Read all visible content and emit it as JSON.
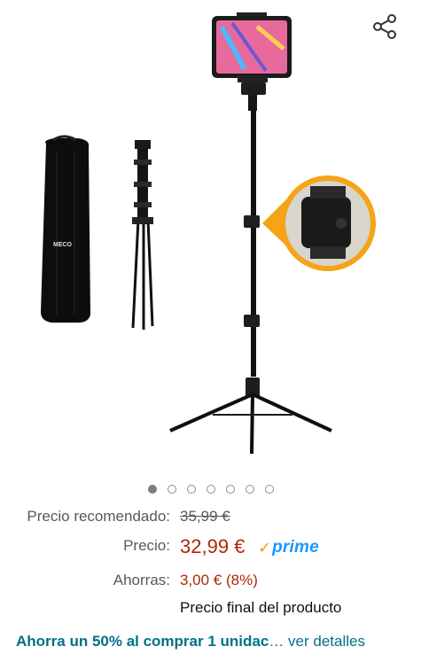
{
  "gallery": {
    "image_count": 7,
    "active_index": 0,
    "bag_logo_text": "MECO",
    "share_icon": "share-icon"
  },
  "pricing": {
    "recommended_label": "Precio recomendado:",
    "recommended_value": "35,99 €",
    "price_label": "Precio:",
    "price_value": "32,99 €",
    "prime_label": "prime",
    "savings_label": "Ahorras:",
    "savings_value": "3,00 € (8%)",
    "final_note": "Precio final del producto"
  },
  "promo": {
    "text": "Ahorra un 50% al comprar 1 unidad",
    "more_link": "ver detalles",
    "ellipsis": "…"
  },
  "colors": {
    "price_red": "#B12704",
    "link_teal": "#007185",
    "prime_blue": "#1A98FF",
    "prime_orange": "#FF9900"
  }
}
